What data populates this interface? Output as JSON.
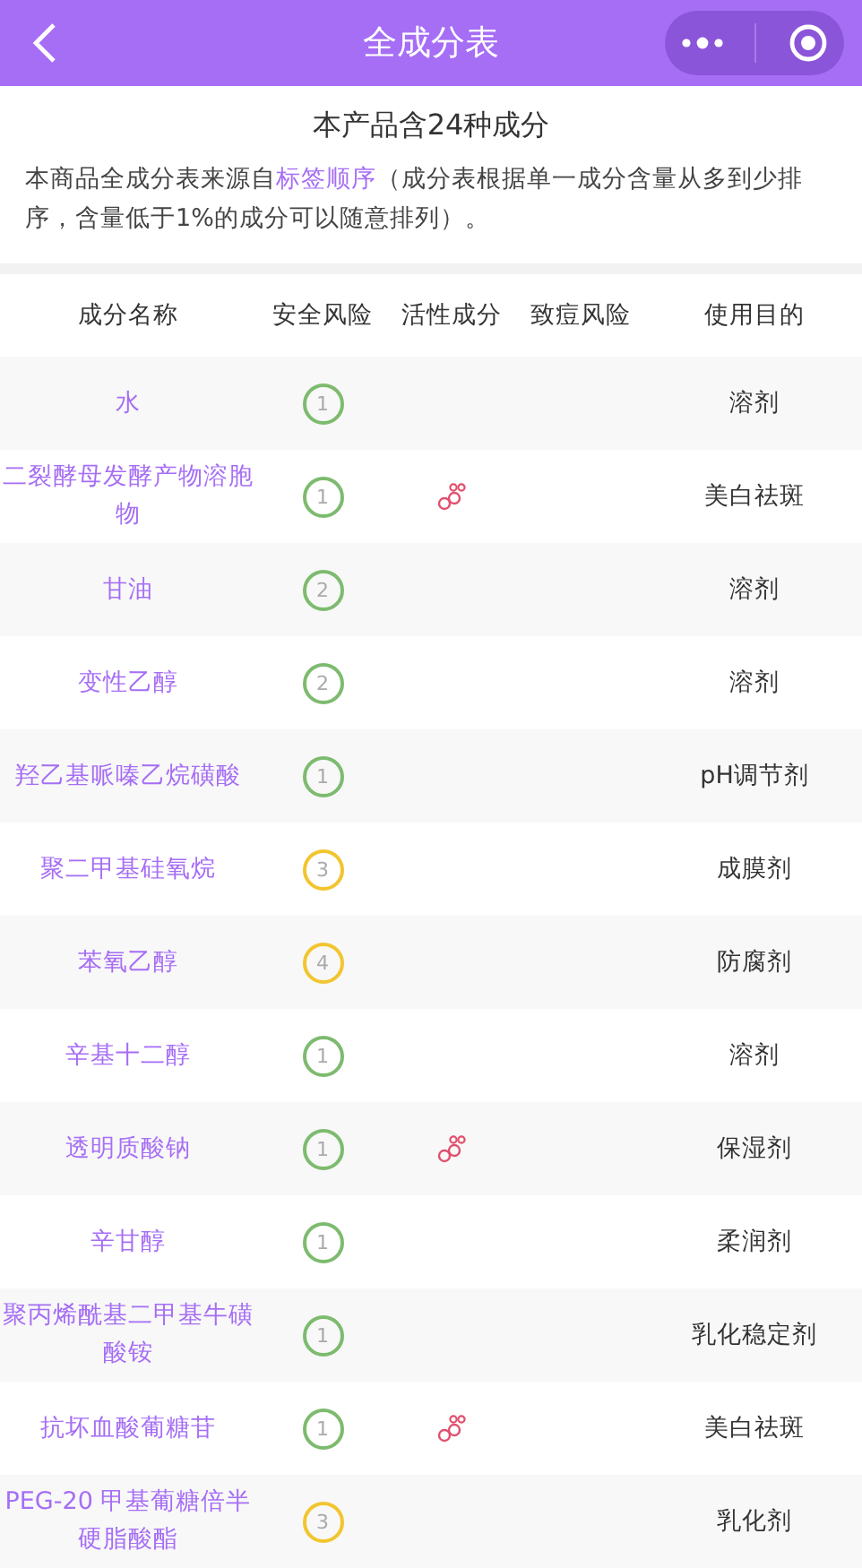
{
  "nav_bar": {
    "title": "全成分表"
  },
  "summary": {
    "title": "本产品含24种成分",
    "note": "本商品全成分表来源自",
    "link": "标签顺序",
    "note_rest": "（成分表根据单一成分含量从多到少排序，含量低于1%的成分可以随意排列）。"
  },
  "table": {
    "columns": [
      "成分名称",
      "安全风险",
      "活性成分",
      "致痘风险",
      "使用目的"
    ],
    "rows": [
      {
        "name": "水",
        "risk": "1",
        "color": "#7dbb6f",
        "active": false,
        "purpose": "溶剂"
      },
      {
        "name": "二裂酵母发酵产物溶胞物",
        "risk": "1",
        "color": "#7dbb6f",
        "active": true,
        "purpose": "美白祛斑"
      },
      {
        "name": "甘油",
        "risk": "2",
        "color": "#7dbb6f",
        "active": false,
        "purpose": "溶剂"
      },
      {
        "name": "变性乙醇",
        "risk": "2",
        "color": "#7dbb6f",
        "active": false,
        "purpose": "溶剂"
      },
      {
        "name": "羟乙基哌嗪乙烷磺酸",
        "risk": "1",
        "color": "#7dbb6f",
        "active": false,
        "purpose": "pH调节剂"
      },
      {
        "name": "聚二甲基硅氧烷",
        "risk": "3",
        "color": "#f2c530",
        "active": false,
        "purpose": "成膜剂"
      },
      {
        "name": "苯氧乙醇",
        "risk": "4",
        "color": "#f2c530",
        "active": false,
        "purpose": "防腐剂"
      },
      {
        "name": "辛基十二醇",
        "risk": "1",
        "color": "#7dbb6f",
        "active": false,
        "purpose": "溶剂"
      },
      {
        "name": "透明质酸钠",
        "risk": "1",
        "color": "#7dbb6f",
        "active": true,
        "purpose": "保湿剂"
      },
      {
        "name": "辛甘醇",
        "risk": "1",
        "color": "#7dbb6f",
        "active": false,
        "purpose": "柔润剂"
      },
      {
        "name": "聚丙烯酰基二甲基牛磺酸铵",
        "risk": "1",
        "color": "#7dbb6f",
        "active": false,
        "purpose": "乳化稳定剂"
      },
      {
        "name": "抗坏血酸葡糖苷",
        "risk": "1",
        "color": "#7dbb6f",
        "active": true,
        "purpose": "美白祛斑"
      },
      {
        "name": "PEG-20 甲基葡糖倍半硬脂酸酯",
        "risk": "3",
        "color": "#f2c530",
        "active": false,
        "purpose": "乳化剂"
      }
    ]
  }
}
